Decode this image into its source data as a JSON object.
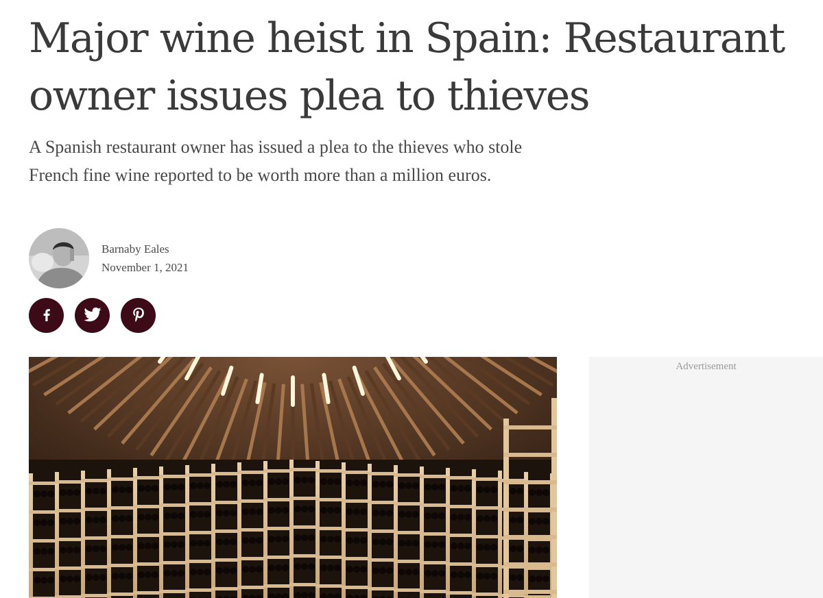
{
  "article": {
    "headline": "Major wine heist in Spain: Restaurant owner issues plea to thieves",
    "standfirst": "A Spanish restaurant owner has issued a plea to the thieves who stole French fine wine reported to be worth more than a million euros."
  },
  "author": {
    "name": "Barnaby Eales",
    "date": "November 1, 2021"
  },
  "social": {
    "buttons": [
      {
        "icon": "facebook-icon"
      },
      {
        "icon": "twitter-icon"
      },
      {
        "icon": "pinterest-icon"
      }
    ],
    "button_color": "#3d0a18"
  },
  "ad": {
    "label": "Advertisement"
  }
}
